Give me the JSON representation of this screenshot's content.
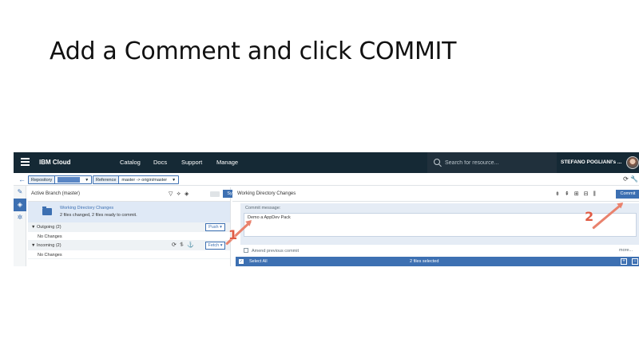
{
  "slide": {
    "title": "Add a Comment and click COMMIT"
  },
  "topbar": {
    "brand": "IBM Cloud",
    "nav": [
      "Catalog",
      "Docs",
      "Support",
      "Manage"
    ],
    "search_placeholder": "Search for resource...",
    "user": "STEFANO POGLIANI's ..."
  },
  "subbar": {
    "repository_label": "Repository",
    "reference_label": "Reference",
    "reference_value": "master -> origin/master"
  },
  "left": {
    "title": "Active Branch (master)",
    "sync_label": "Sync",
    "wdc_title": "Working Directory Changes",
    "wdc_summary": "2 files changed, 2 files ready to commit.",
    "outgoing_label": "▼ Outgoing (2)",
    "push_label": "Push ▾",
    "outgoing_body": "No Changes",
    "incoming_label": "▼ Incoming (2)",
    "fetch_label": "Fetch ▾",
    "incoming_body": "No Changes"
  },
  "right": {
    "title": "Working Directory Changes",
    "commit_label": "Commit",
    "message_label": "Commit message:",
    "message_value": "Demo a AppDev Pack",
    "amend_label": "Amend previous commit",
    "more_label": "more...",
    "select_all_label": "Select All",
    "selected_count": "2 files selected"
  },
  "annotations": {
    "step1": "1",
    "step2": "2"
  },
  "colors": {
    "topbar": "#152935",
    "accent": "#3d70b2",
    "annotation": "#e05c45"
  }
}
